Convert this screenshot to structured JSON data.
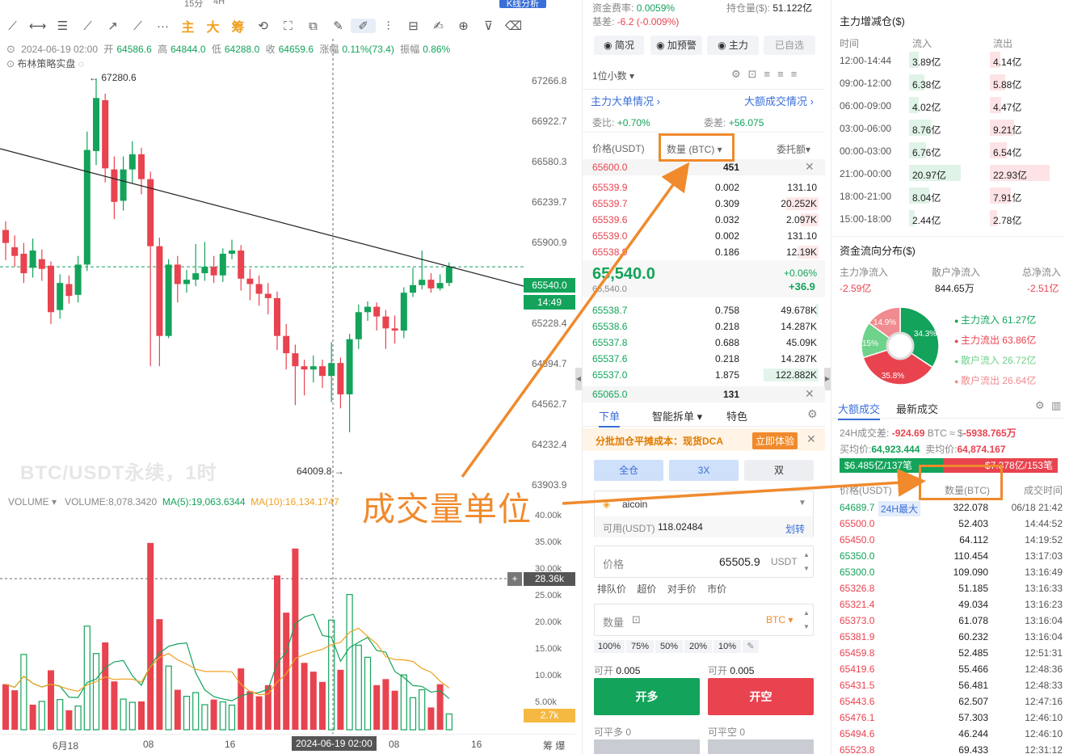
{
  "toolbar": {
    "top_items": [
      "ⓓ",
      "⊙",
      "⊘",
      "□",
      "◧",
      "⋘",
      "时",
      "15分",
      "4H",
      "1s",
      "▤",
      "◎",
      "⚇",
      "K线分析"
    ],
    "zhu": "主",
    "da": "大",
    "chou": "筹"
  },
  "candle_info": {
    "date": "2024-06-19 02:00",
    "open_label": "开",
    "open": "64586.6",
    "high_label": "高",
    "high": "64844.0",
    "low_label": "低",
    "low": "64288.0",
    "close_label": "收",
    "close": "64659.6",
    "change_label": "涨幅",
    "change": "0.11%(73.4)",
    "amp_label": "振幅",
    "amp": "0.86%"
  },
  "strategy_label": "布林策略实盘",
  "watermark": "BTC/USDT永续，1时",
  "price_axis": [
    "67266.8",
    "66922.7",
    "66580.3",
    "66239.7",
    "65900.9",
    "65540.0",
    "65228.4",
    "64894.7",
    "64562.7",
    "64232.4",
    "63903.9"
  ],
  "current_price_tag": "65540.0",
  "countdown_tag": "14:49",
  "high_marker": "67280.6",
  "low_marker": "64009.8",
  "volume": {
    "title": "VOLUME",
    "value": "VOLUME:8,078.3420",
    "ma5": "MA(5):19,063.6344",
    "ma10": "MA(10):16,134.1747",
    "axis": [
      "40.00k",
      "35.00k",
      "30.00k",
      "25.00k",
      "20.00k",
      "15.00k",
      "10.00k",
      "5.00k"
    ],
    "cross_tag": "28.36k",
    "last_tag": "2.7k"
  },
  "time_axis": [
    "6月18",
    "08",
    "16",
    "2024-06-19 02:00",
    "08",
    "16"
  ],
  "chart_corner": "筹 爆",
  "annotation": "成交量单位",
  "orderbook": {
    "funding_label": "资金费率:",
    "funding": "0.0059%",
    "basis_label": "基差:",
    "basis": "-6.2 (-0.009%)",
    "oi_label": "持仓量($):",
    "oi": "51.122亿",
    "buttons": [
      "简况",
      "加预警",
      "主力",
      "已自选"
    ],
    "precision": "1位小数",
    "main_order": "主力大单情况",
    "big_trade": "大额成交情况",
    "ratio_label": "委比:",
    "ratio": "+0.70%",
    "diff_label": "委差:",
    "diff": "+56.075",
    "col_price": "价格(USDT)",
    "col_qty": "数量 (BTC)",
    "col_amount": "委托额",
    "top_ask": {
      "price": "65600.0",
      "qty": "451"
    },
    "asks": [
      {
        "price": "65539.9",
        "qty": "0.002",
        "amt": "131.10"
      },
      {
        "price": "65539.7",
        "qty": "0.309",
        "amt": "20.252K"
      },
      {
        "price": "65539.6",
        "qty": "0.032",
        "amt": "2.097K"
      },
      {
        "price": "65539.0",
        "qty": "0.002",
        "amt": "131.10"
      },
      {
        "price": "65538.9",
        "qty": "0.186",
        "amt": "12.19K"
      }
    ],
    "last_price": "65,540.0",
    "last_pct": "+0.06%",
    "index_price": "65,540.0",
    "last_diff": "+36.9",
    "bids": [
      {
        "price": "65538.7",
        "qty": "0.758",
        "amt": "49.678K"
      },
      {
        "price": "65538.6",
        "qty": "0.218",
        "amt": "14.287K"
      },
      {
        "price": "65537.8",
        "qty": "0.688",
        "amt": "45.09K"
      },
      {
        "price": "65537.6",
        "qty": "0.218",
        "amt": "14.287K"
      },
      {
        "price": "65537.0",
        "qty": "1.875",
        "amt": "122.882K"
      }
    ],
    "bottom_bid": {
      "price": "65065.0",
      "qty": "131"
    }
  },
  "trade_form": {
    "tabs": [
      "下单",
      "智能拆单",
      "特色"
    ],
    "dca_text": "分批加仓平摊成本：现货DCA",
    "dca_btn": "立即体验",
    "mode_btns": [
      "全仓",
      "3X",
      "双"
    ],
    "exchange": "aicoin",
    "avail_label": "可用(USDT)",
    "avail": "118.02484",
    "transfer": "划转",
    "price_label": "价格",
    "price_value": "65505.9",
    "price_unit": "USDT",
    "order_types": [
      "排队价",
      "超价",
      "对手价",
      "市价"
    ],
    "qty_label": "数量",
    "qty_unit": "BTC",
    "percents": [
      "100%",
      "75%",
      "50%",
      "20%",
      "10%"
    ],
    "can_open_long_label": "可开",
    "can_open_long": "0.005",
    "can_open_short_label": "可开",
    "can_open_short": "0.005",
    "buy_btn": "开多",
    "sell_btn": "开空",
    "can_close_long": "可平多 0",
    "can_close_short": "可平空 0"
  },
  "right_panel": {
    "title": "主力增减仓($)",
    "headers": [
      "时间",
      "流入",
      "流出"
    ],
    "rows": [
      {
        "time": "12:00-14:44",
        "in": "3.89亿",
        "out": "4.14亿"
      },
      {
        "time": "09:00-12:00",
        "in": "6.38亿",
        "out": "5.88亿"
      },
      {
        "time": "06:00-09:00",
        "in": "4.02亿",
        "out": "4.47亿"
      },
      {
        "time": "03:00-06:00",
        "in": "8.76亿",
        "out": "9.21亿"
      },
      {
        "time": "00:00-03:00",
        "in": "6.76亿",
        "out": "6.54亿"
      },
      {
        "time": "21:00-00:00",
        "in": "20.97亿",
        "out": "22.93亿"
      },
      {
        "time": "18:00-21:00",
        "in": "8.04亿",
        "out": "7.91亿"
      },
      {
        "time": "15:00-18:00",
        "in": "2.44亿",
        "out": "2.78亿"
      }
    ],
    "flow_title": "资金流向分布($)",
    "flow_headers": [
      "主力净流入",
      "散户净流入",
      "总净流入"
    ],
    "flow_values": [
      "-2.59亿",
      "844.65万",
      "-2.51亿"
    ],
    "pie": [
      {
        "label": "34.3%",
        "value": 34.3,
        "color": "#13a35a"
      },
      {
        "label": "35.8%",
        "value": 35.8,
        "color": "#e8434f"
      },
      {
        "label": "15%",
        "value": 15.0,
        "color": "#6fd28a"
      },
      {
        "label": "14.9%",
        "value": 14.9,
        "color": "#f08b8f"
      }
    ],
    "legend": [
      {
        "text": "主力流入 61.27亿",
        "color": "#13a35a"
      },
      {
        "text": "主力流出 63.86亿",
        "color": "#e8434f"
      },
      {
        "text": "散户流入 26.72亿",
        "color": "#6fd28a"
      },
      {
        "text": "散户流出 26.64亿",
        "color": "#f08b8f"
      }
    ],
    "trade_tabs": [
      "大额成交",
      "最新成交"
    ],
    "diff_label": "24H成交差:",
    "diff": "-924.69",
    "diff_unit": "BTC ≈ $",
    "diff_usd": "-5938.765万",
    "buy_avg_label": "买均价:",
    "buy_avg": "64,923.444",
    "sell_avg_label": "卖均价:",
    "sell_avg": "64,874.167",
    "buy_bar": "$6.485亿/137笔",
    "sell_bar": "$7.378亿/153笔",
    "trade_headers": [
      "价格(USDT)",
      "数量(BTC)",
      "成交时间"
    ],
    "trades": [
      {
        "price": "64689.7",
        "badge": "24H最大",
        "qty": "322.078",
        "time": "06/18 21:42",
        "side": "buy"
      },
      {
        "price": "65500.0",
        "qty": "52.403",
        "time": "14:44:52",
        "side": "sell"
      },
      {
        "price": "65450.0",
        "qty": "64.112",
        "time": "14:19:52",
        "side": "sell"
      },
      {
        "price": "65350.0",
        "qty": "110.454",
        "time": "13:17:03",
        "side": "buy"
      },
      {
        "price": "65300.0",
        "qty": "109.090",
        "time": "13:16:49",
        "side": "buy"
      },
      {
        "price": "65326.8",
        "qty": "51.185",
        "time": "13:16:33",
        "side": "sell"
      },
      {
        "price": "65321.4",
        "qty": "49.034",
        "time": "13:16:23",
        "side": "sell"
      },
      {
        "price": "65373.0",
        "qty": "61.078",
        "time": "13:16:04",
        "side": "sell"
      },
      {
        "price": "65381.9",
        "qty": "60.232",
        "time": "13:16:04",
        "side": "sell"
      },
      {
        "price": "65459.8",
        "qty": "52.485",
        "time": "12:51:31",
        "side": "sell"
      },
      {
        "price": "65419.6",
        "qty": "55.466",
        "time": "12:48:36",
        "side": "sell"
      },
      {
        "price": "65431.5",
        "qty": "56.481",
        "time": "12:48:33",
        "side": "sell"
      },
      {
        "price": "65443.6",
        "qty": "62.507",
        "time": "12:47:16",
        "side": "sell"
      },
      {
        "price": "65476.1",
        "qty": "57.303",
        "time": "12:46:10",
        "side": "sell"
      },
      {
        "price": "65494.6",
        "qty": "46.244",
        "time": "12:46:10",
        "side": "sell"
      },
      {
        "price": "65523.8",
        "qty": "69.433",
        "time": "12:31:12",
        "side": "sell"
      }
    ]
  },
  "candles": [
    [
      65880,
      65760,
      65960,
      65600
    ],
    [
      65720,
      65640,
      65830,
      65540
    ],
    [
      65660,
      65480,
      65760,
      65390
    ],
    [
      65530,
      65690,
      65800,
      65440
    ],
    [
      65610,
      65520,
      65700,
      65410
    ],
    [
      65550,
      65120,
      65590,
      65010
    ],
    [
      65140,
      65390,
      65470,
      65060
    ],
    [
      65380,
      65270,
      65460,
      65200
    ],
    [
      65280,
      65560,
      65640,
      65210
    ],
    [
      65560,
      66620,
      66790,
      65500
    ],
    [
      66610,
      67100,
      67280,
      66480
    ],
    [
      67080,
      66450,
      67140,
      66320
    ],
    [
      66440,
      66140,
      66560,
      65980
    ],
    [
      66150,
      66440,
      66560,
      66060
    ],
    [
      66440,
      66580,
      66700,
      66310
    ],
    [
      66580,
      66350,
      66640,
      66210
    ],
    [
      66350,
      65730,
      66420,
      64620
    ],
    [
      65730,
      64900,
      65810,
      64620
    ],
    [
      64900,
      65560,
      65610,
      64880
    ],
    [
      65560,
      65380,
      65640,
      65210
    ],
    [
      65380,
      65420,
      65510,
      65300
    ],
    [
      65420,
      65480,
      65750,
      65360
    ],
    [
      65480,
      65540,
      65770,
      65410
    ],
    [
      65540,
      65460,
      65640,
      65390
    ],
    [
      65460,
      65660,
      65710,
      65400
    ],
    [
      65660,
      65690,
      65790,
      65610
    ],
    [
      65690,
      65430,
      65740,
      65320
    ],
    [
      65430,
      65380,
      65520,
      65230
    ],
    [
      65380,
      65290,
      65460,
      65180
    ],
    [
      65290,
      65250,
      65390,
      65100
    ],
    [
      65250,
      64900,
      65310,
      64770
    ],
    [
      64900,
      64740,
      65010,
      64590
    ],
    [
      64740,
      64620,
      64820,
      64260
    ],
    [
      64620,
      64590,
      64680,
      64350
    ],
    [
      64590,
      64620,
      64720,
      64470
    ],
    [
      64620,
      64530,
      64680,
      64420
    ],
    [
      64530,
      64650,
      64844,
      64288
    ],
    [
      64650,
      64360,
      64700,
      64230
    ],
    [
      64360,
      64870,
      64920,
      64010
    ],
    [
      64870,
      65120,
      65190,
      64780
    ],
    [
      65120,
      65170,
      65220,
      65040
    ],
    [
      65170,
      65080,
      65210,
      64950
    ],
    [
      65080,
      64970,
      65140,
      64780
    ],
    [
      64970,
      64950,
      65090,
      64830
    ],
    [
      64950,
      65300,
      65350,
      64880
    ],
    [
      65300,
      65370,
      65530,
      65260
    ],
    [
      65370,
      65420,
      65690,
      65330
    ],
    [
      65420,
      65340,
      65480,
      65300
    ],
    [
      65340,
      65390,
      65470,
      65320
    ],
    [
      65390,
      65540,
      65580,
      65360
    ]
  ],
  "volumes": [
    [
      9.8,
      0
    ],
    [
      8.5,
      0
    ],
    [
      16.2,
      1
    ],
    [
      5.4,
      0
    ],
    [
      6.1,
      1
    ],
    [
      12.8,
      0
    ],
    [
      6.5,
      1
    ],
    [
      4.2,
      0
    ],
    [
      5.1,
      1
    ],
    [
      22.3,
      1
    ],
    [
      16.4,
      1
    ],
    [
      18.8,
      0
    ],
    [
      10.4,
      0
    ],
    [
      6.6,
      1
    ],
    [
      5.9,
      1
    ],
    [
      6.1,
      0
    ],
    [
      40.2,
      0
    ],
    [
      23.8,
      0
    ],
    [
      13.7,
      1
    ],
    [
      8.6,
      0
    ],
    [
      7.2,
      1
    ],
    [
      8.0,
      1
    ],
    [
      5.4,
      1
    ],
    [
      6.5,
      0
    ],
    [
      6.0,
      1
    ],
    [
      5.3,
      1
    ],
    [
      13.2,
      0
    ],
    [
      8.3,
      0
    ],
    [
      7.2,
      0
    ],
    [
      9.6,
      0
    ],
    [
      33.2,
      0
    ],
    [
      25.2,
      0
    ],
    [
      39.0,
      0
    ],
    [
      14.4,
      0
    ],
    [
      12.5,
      0
    ],
    [
      10.3,
      0
    ],
    [
      23.6,
      1
    ],
    [
      12.9,
      0
    ],
    [
      29.1,
      1
    ],
    [
      18.2,
      1
    ],
    [
      15.6,
      1
    ],
    [
      9.6,
      0
    ],
    [
      10.9,
      0
    ],
    [
      8.4,
      0
    ],
    [
      11.8,
      1
    ],
    [
      6.9,
      1
    ],
    [
      8.6,
      1
    ],
    [
      4.8,
      0
    ],
    [
      9.8,
      0
    ],
    [
      3.4,
      1
    ]
  ]
}
